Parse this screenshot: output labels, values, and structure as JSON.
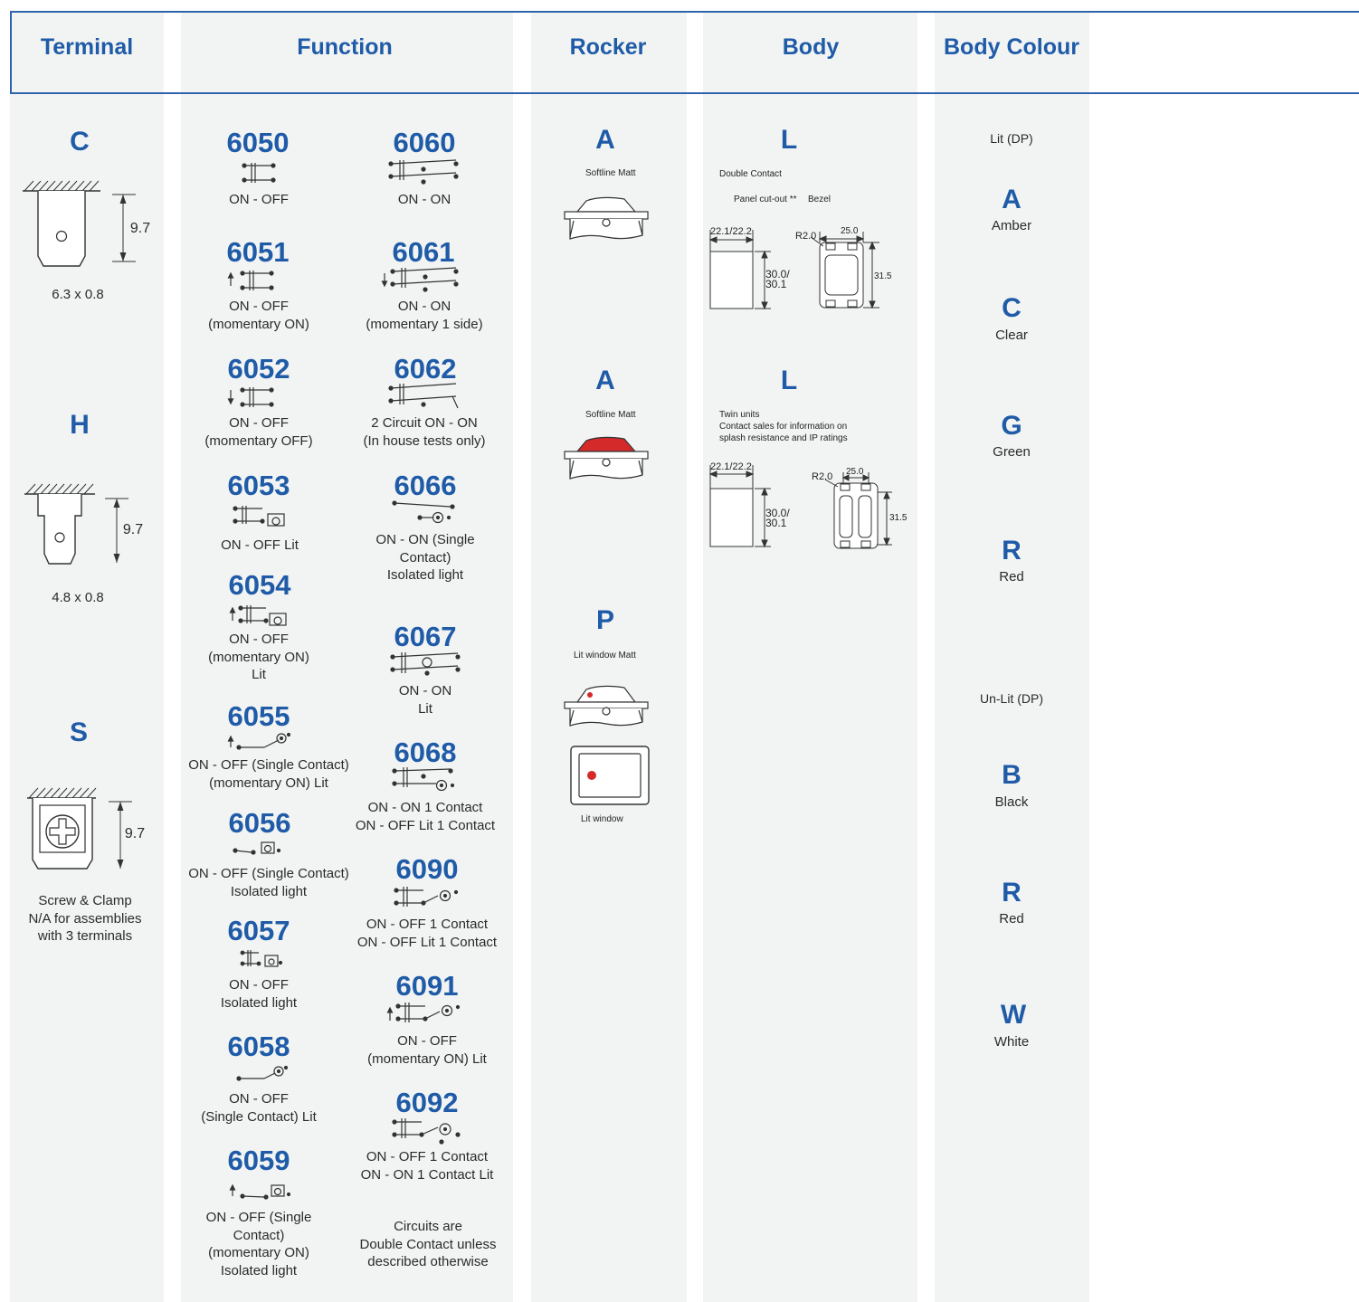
{
  "headers": {
    "terminal": "Terminal",
    "function": "Function",
    "rocker": "Rocker",
    "body": "Body",
    "body_colour": "Body Colour"
  },
  "terminals": [
    {
      "code": "C",
      "dim": "9.7",
      "label": "6.3 x 0.8"
    },
    {
      "code": "H",
      "dim": "9.7",
      "label": "4.8 x 0.8"
    },
    {
      "code": "S",
      "dim": "9.7",
      "label": "Screw & Clamp\nN/A for assemblies\nwith 3 terminals"
    }
  ],
  "functions_left": [
    {
      "code": "6050",
      "desc": "ON - OFF"
    },
    {
      "code": "6051",
      "desc": "ON - OFF\n(momentary ON)"
    },
    {
      "code": "6052",
      "desc": "ON - OFF\n(momentary OFF)"
    },
    {
      "code": "6053",
      "desc": "ON - OFF Lit"
    },
    {
      "code": "6054",
      "desc": "ON - OFF\n(momentary ON)\nLit"
    },
    {
      "code": "6055",
      "desc": "ON - OFF (Single Contact)\n(momentary ON) Lit"
    },
    {
      "code": "6056",
      "desc": "ON - OFF (Single Contact)\nIsolated light"
    },
    {
      "code": "6057",
      "desc": "ON - OFF\nIsolated light"
    },
    {
      "code": "6058",
      "desc": "ON - OFF\n(Single Contact) Lit"
    },
    {
      "code": "6059",
      "desc": "ON - OFF (Single\nContact)\n(momentary ON)\nIsolated light"
    }
  ],
  "functions_right": [
    {
      "code": "6060",
      "desc": "ON - ON"
    },
    {
      "code": "6061",
      "desc": "ON - ON\n(momentary 1 side)"
    },
    {
      "code": "6062",
      "desc": "2 Circuit ON - ON\n(In house tests only)"
    },
    {
      "code": "6066",
      "desc": "ON - ON (Single\nContact)\nIsolated light"
    },
    {
      "code": "6067",
      "desc": "ON - ON\nLit"
    },
    {
      "code": "6068",
      "desc": "ON - ON 1 Contact\nON - OFF Lit 1 Contact"
    },
    {
      "code": "6090",
      "desc": "ON - OFF 1 Contact\nON - OFF Lit 1 Contact"
    },
    {
      "code": "6091",
      "desc": "ON - OFF\n(momentary ON) Lit"
    },
    {
      "code": "6092",
      "desc": "ON - OFF 1 Contact\nON - ON 1 Contact Lit"
    }
  ],
  "function_note": "Circuits are\nDouble Contact unless\ndescribed otherwise",
  "rockers": [
    {
      "code": "A",
      "label": "Softline Matt",
      "colour": "#ffffff"
    },
    {
      "code": "A",
      "label": "Softline Matt",
      "colour": "#d42a2a"
    },
    {
      "code": "P",
      "label": "Lit window Matt",
      "colour": "#ffffff",
      "window_label": "Lit window"
    }
  ],
  "bodies": [
    {
      "code": "L",
      "lines": "Double Contact",
      "cutout_label": "Panel cut-out **",
      "bezel_label": "Bezel",
      "dims": {
        "width": "22.1/22.2",
        "height": "30.0/\n30.1",
        "bezel_w": "25.0",
        "bezel_h": "31.5",
        "radius": "R2.0"
      }
    },
    {
      "code": "L",
      "lines": "Twin units\nContact sales for information on\nsplash resistance and IP ratings",
      "dims": {
        "width": "22.1/22.2",
        "height": "30.0/\n30.1",
        "bezel_w": "25.0",
        "bezel_h": "31.5",
        "radius": "R2.0"
      }
    }
  ],
  "body_colours": {
    "lit_heading": "Lit (DP)",
    "lit": [
      {
        "code": "A",
        "name": "Amber"
      },
      {
        "code": "C",
        "name": "Clear"
      },
      {
        "code": "G",
        "name": "Green"
      },
      {
        "code": "R",
        "name": "Red"
      }
    ],
    "unlit_heading": "Un-Lit (DP)",
    "unlit": [
      {
        "code": "B",
        "name": "Black"
      },
      {
        "code": "R",
        "name": "Red"
      },
      {
        "code": "W",
        "name": "White"
      }
    ]
  },
  "colors": {
    "accent": "#1f5ba7",
    "column_bg": "#f2f4f4",
    "rocker_red": "#d42a2a"
  }
}
